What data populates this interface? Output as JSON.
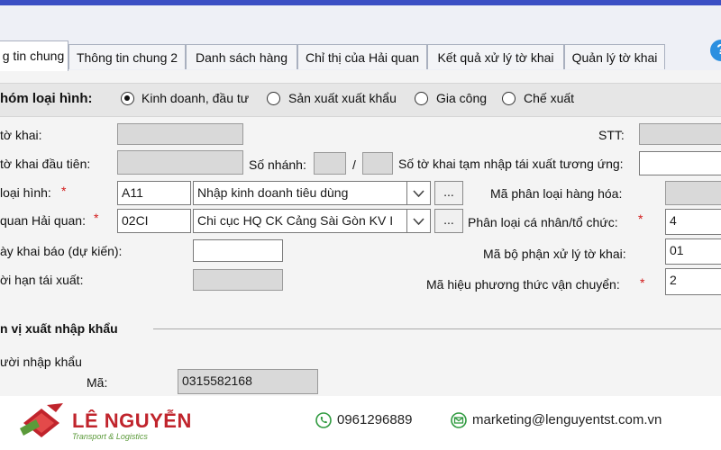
{
  "tabs": [
    {
      "label": "g tin chung",
      "active": true
    },
    {
      "label": "Thông tin chung 2"
    },
    {
      "label": "Danh sách hàng"
    },
    {
      "label": "Chỉ thị của Hải quan"
    },
    {
      "label": "Kết quả xử lý tờ khai"
    },
    {
      "label": "Quản lý tờ khai"
    }
  ],
  "help_icon": "question-circle-icon",
  "group": {
    "label": "hóm loại hình:",
    "options": [
      {
        "label": "Kinh doanh, đầu tư",
        "selected": true
      },
      {
        "label": "Sản xuất xuất khẩu",
        "selected": false
      },
      {
        "label": "Gia công",
        "selected": false
      },
      {
        "label": "Chế xuất",
        "selected": false
      }
    ]
  },
  "form": {
    "so_to_khai_label": "tờ khai:",
    "stt_label": "STT:",
    "to_khai_dau_tien_label": "tờ khai đầu tiên:",
    "so_nhanh_label": "Số nhánh:",
    "slash": "/",
    "tam_nhap_label": "Số tờ khai tạm nhập tái xuất tương ứng:",
    "loai_hinh_label": "loại hình:",
    "loai_hinh_code": "A11",
    "loai_hinh_name": "Nhập kinh doanh tiêu dùng",
    "ma_phan_loai_label": "Mã phân loại hàng hóa:",
    "co_quan_label": "quan Hải quan:",
    "co_quan_code": "02CI",
    "co_quan_name": "Chi cục HQ CK Cảng Sài Gòn KV I",
    "phan_loai_cn_label": "Phân loại cá nhân/tổ chức:",
    "phan_loai_cn_value": "4",
    "ngay_khai_label": "ày khai báo (dự kiến):",
    "ma_bo_phan_label": "Mã bộ phận xử lý tờ khai:",
    "ma_bo_phan_value": "01",
    "thoi_han_label": "ời hạn tái xuất:",
    "ma_hieu_label": "Mã hiệu phương thức vận chuyển:",
    "ma_hieu_value": "2",
    "dots": "...",
    "required": "*"
  },
  "section": {
    "title": "n vị xuất nhập khẩu",
    "nguoi_nk_label": "ười nhập khẩu",
    "ma_label": "Mã:",
    "ma_value": "0315582168"
  },
  "footer": {
    "brand": "LÊ NGUYỄN",
    "tagline": "Transport & Logistics",
    "phone": "0961296889",
    "email": "marketing@lenguyentst.com.vn",
    "accent": "#c0242c",
    "green": "#5b9a3a"
  }
}
